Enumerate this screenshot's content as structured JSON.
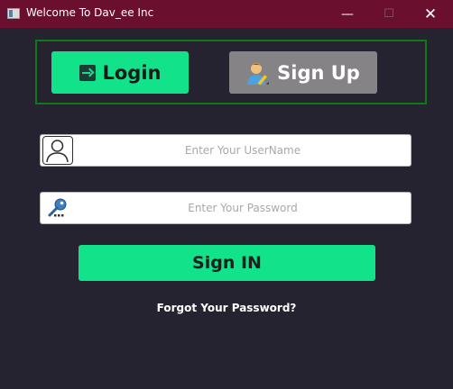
{
  "window": {
    "title": "Welcome To Dav_ee Inc",
    "controls": {
      "minimize": "—",
      "maximize": "☐",
      "close": "✕"
    }
  },
  "tabs": {
    "login_label": "Login",
    "signup_label": "Sign Up"
  },
  "form": {
    "username_placeholder": "Enter Your UserName",
    "username_value": "",
    "password_placeholder": "Enter Your Password",
    "password_value": "",
    "signin_label": "Sign IN",
    "forgot_label": "Forgot Your Password?"
  },
  "colors": {
    "titlebar": "#6b0f2e",
    "background": "#252330",
    "accent_green": "#12e38a",
    "tab_inactive": "#858385",
    "panel_border": "#0d7a16"
  },
  "icons": {
    "login": "login-arrow-icon",
    "signup": "user-edit-icon",
    "username": "user-silhouette-icon",
    "password": "key-icon"
  }
}
